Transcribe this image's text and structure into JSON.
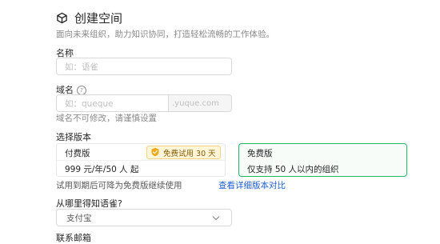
{
  "header": {
    "title": "创建空间",
    "subtitle": "面向未来组织，助力知识协同，打造轻松流畅的工作体验。"
  },
  "form": {
    "name": {
      "label": "名称",
      "placeholder": "如：语雀"
    },
    "domain": {
      "label": "域名",
      "placeholder": "如：queque",
      "suffix": ".yuque.com",
      "hint": "域名不可修改，请谨慎设置"
    },
    "plan": {
      "label": "选择版本",
      "paid": {
        "name": "付费版",
        "badge": "免费试用 30 天",
        "desc": "999 元/年/50 人 起"
      },
      "free": {
        "name": "免费版",
        "desc": "仅支持 50 人以内的组织"
      },
      "trial_note": "试用到期后可降为免费版继续使用",
      "compare_link": "查看详细版本对比"
    },
    "source": {
      "label": "从哪里得知语雀?",
      "selected": "支付宝"
    },
    "email": {
      "label": "联系邮箱"
    }
  },
  "colors": {
    "selected_border": "#25b864",
    "link": "#1f5ed1"
  }
}
